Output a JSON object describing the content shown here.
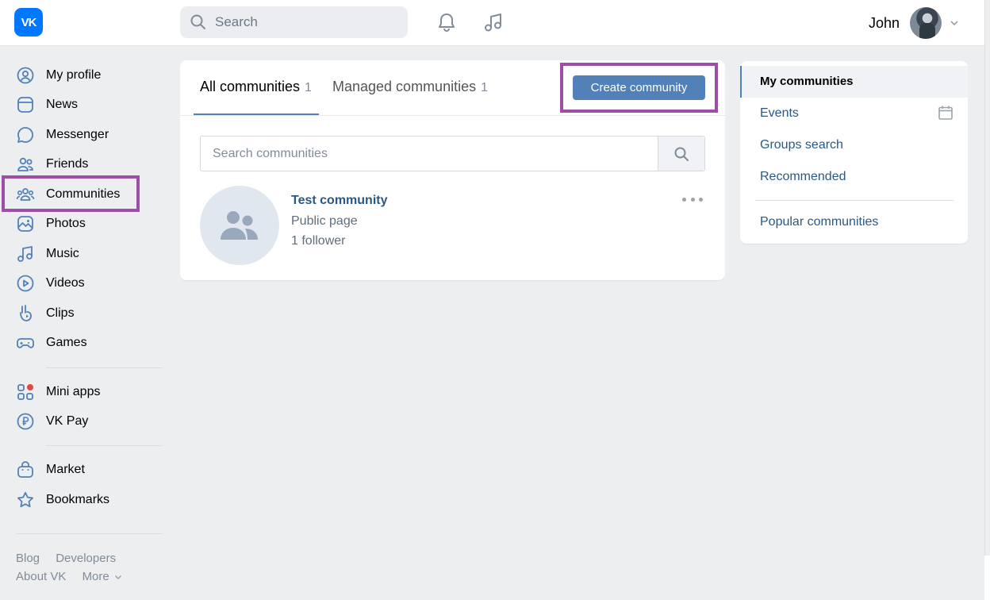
{
  "header": {
    "logo_text": "VK",
    "search_placeholder": "Search",
    "user_name": "John"
  },
  "nav": {
    "items": [
      {
        "label": "My profile",
        "icon": "user-circle-icon"
      },
      {
        "label": "News",
        "icon": "newspaper-icon"
      },
      {
        "label": "Messenger",
        "icon": "chat-bubble-icon"
      },
      {
        "label": "Friends",
        "icon": "friends-icon"
      },
      {
        "label": "Communities",
        "icon": "communities-icon"
      },
      {
        "label": "Photos",
        "icon": "photo-icon"
      },
      {
        "label": "Music",
        "icon": "music-note-icon"
      },
      {
        "label": "Videos",
        "icon": "play-circle-icon"
      },
      {
        "label": "Clips",
        "icon": "clips-icon"
      },
      {
        "label": "Games",
        "icon": "gamepad-icon"
      },
      {
        "label": "Mini apps",
        "icon": "mini-apps-icon"
      },
      {
        "label": "VK Pay",
        "icon": "ruble-coin-icon"
      },
      {
        "label": "Market",
        "icon": "shopping-bag-icon"
      },
      {
        "label": "Bookmarks",
        "icon": "star-icon"
      }
    ],
    "footer": {
      "blog": "Blog",
      "developers": "Developers",
      "about": "About VK",
      "more": "More"
    }
  },
  "main": {
    "tabs": [
      {
        "label": "All communities",
        "count": "1"
      },
      {
        "label": "Managed communities",
        "count": "1"
      }
    ],
    "create_button": "Create community",
    "search_placeholder": "Search communities",
    "community": {
      "name": "Test community",
      "type": "Public page",
      "followers": "1 follower"
    }
  },
  "right_menu": {
    "items": [
      "My communities",
      "Events",
      "Groups search",
      "Recommended",
      "Popular communities"
    ]
  },
  "colors": {
    "accent": "#5181b8",
    "link": "#2a5885",
    "highlight": "#9d4ea5",
    "logo": "#0077ff"
  }
}
